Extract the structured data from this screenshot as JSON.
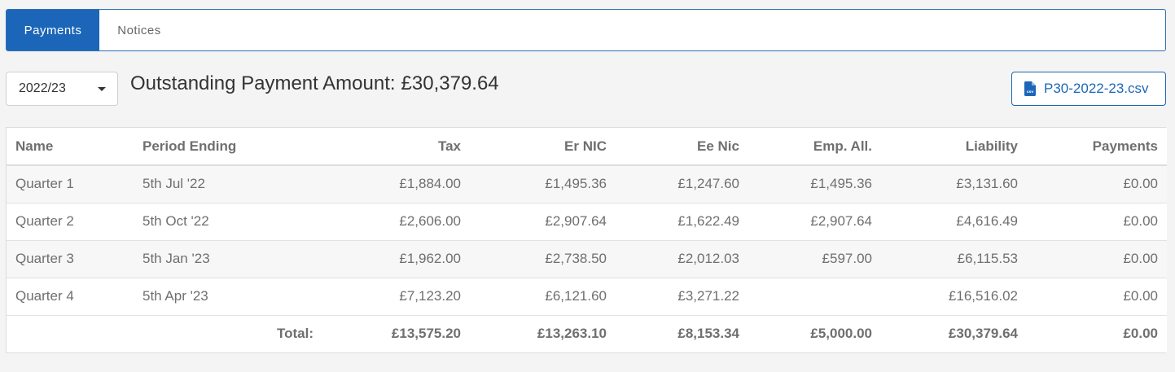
{
  "tabs": [
    {
      "label": "Payments",
      "active": true
    },
    {
      "label": "Notices",
      "active": false
    }
  ],
  "year_select": {
    "value": "2022/23"
  },
  "outstanding": {
    "label": "Outstanding Payment Amount:",
    "amount": "£30,379.64"
  },
  "export": {
    "label": "P30-2022-23.csv",
    "icon": "csv-file-icon",
    "icon_text": "csv"
  },
  "colors": {
    "accent": "#1b66b8",
    "text": "#6f6f6f",
    "background": "#f4f4f4"
  },
  "table": {
    "columns": [
      "Name",
      "Period Ending",
      "Tax",
      "Er NIC",
      "Ee Nic",
      "Emp. All.",
      "Liability",
      "Payments"
    ],
    "rows": [
      [
        "Quarter 1",
        "5th Jul '22",
        "£1,884.00",
        "£1,495.36",
        "£1,247.60",
        "£1,495.36",
        "£3,131.60",
        "£0.00"
      ],
      [
        "Quarter 2",
        "5th Oct '22",
        "£2,606.00",
        "£2,907.64",
        "£1,622.49",
        "£2,907.64",
        "£4,616.49",
        "£0.00"
      ],
      [
        "Quarter 3",
        "5th Jan '23",
        "£1,962.00",
        "£2,738.50",
        "£2,012.03",
        "£597.00",
        "£6,115.53",
        "£0.00"
      ],
      [
        "Quarter 4",
        "5th Apr '23",
        "£7,123.20",
        "£6,121.60",
        "£3,271.22",
        "",
        "£16,516.02",
        "£0.00"
      ]
    ],
    "totals": {
      "label": "Total:",
      "values": [
        "£13,575.20",
        "£13,263.10",
        "£8,153.34",
        "£5,000.00",
        "£30,379.64",
        "£0.00"
      ]
    }
  }
}
